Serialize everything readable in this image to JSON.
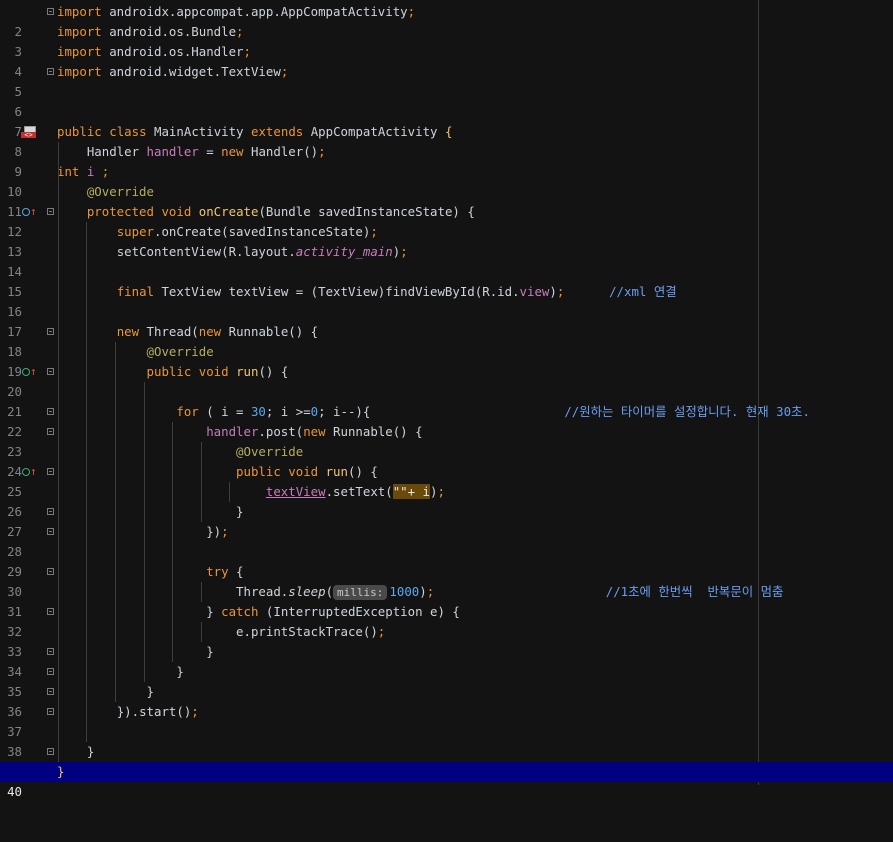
{
  "editor": {
    "current_line": 40,
    "lines": [
      {
        "n": "2",
        "text": "import androidx.appcompat.app.AppCompatActivity;"
      },
      {
        "n": "3",
        "text": "import android.os.Bundle;"
      },
      {
        "n": "4",
        "text": "import android.os.Handler;"
      },
      {
        "n": "5",
        "text": "import android.widget.TextView;"
      },
      {
        "n": "6",
        "text": ""
      },
      {
        "n": "7",
        "text": ""
      },
      {
        "n": "8",
        "text": "public class MainActivity extends AppCompatActivity {"
      },
      {
        "n": "9",
        "text": "    Handler handler = new Handler();"
      },
      {
        "n": "10",
        "text": "int i ;"
      },
      {
        "n": "11",
        "text": "    @Override"
      },
      {
        "n": "12",
        "text": "    protected void onCreate(Bundle savedInstanceState) {"
      },
      {
        "n": "13",
        "text": "        super.onCreate(savedInstanceState);"
      },
      {
        "n": "14",
        "text": "        setContentView(R.layout.activity_main);"
      },
      {
        "n": "15",
        "text": ""
      },
      {
        "n": "16",
        "text": "        final TextView textView = (TextView)findViewById(R.id.view);      //xml 연결"
      },
      {
        "n": "17",
        "text": ""
      },
      {
        "n": "18",
        "text": "        new Thread(new Runnable() {"
      },
      {
        "n": "19",
        "text": "            @Override"
      },
      {
        "n": "20",
        "text": "            public void run() {"
      },
      {
        "n": "21",
        "text": ""
      },
      {
        "n": "22",
        "text": "                for ( i = 30; i >=0; i--){                             //원하는 타이머를 설정합니다. 현재 30초."
      },
      {
        "n": "23",
        "text": "                    handler.post(new Runnable() {"
      },
      {
        "n": "24",
        "text": "                        @Override"
      },
      {
        "n": "25",
        "text": "                        public void run() {"
      },
      {
        "n": "26",
        "text": "                            textView.setText(\"\"+ i);"
      },
      {
        "n": "27",
        "text": "                        }"
      },
      {
        "n": "28",
        "text": "                    });"
      },
      {
        "n": "29",
        "text": ""
      },
      {
        "n": "30",
        "text": "                    try {"
      },
      {
        "n": "31",
        "text": "                        Thread.sleep( millis: 1000);                         //1초에 한번씩  반복문이 멈춤"
      },
      {
        "n": "32",
        "text": "                    } catch (InterruptedException e) {"
      },
      {
        "n": "33",
        "text": "                        e.printStackTrace();"
      },
      {
        "n": "34",
        "text": "                    }"
      },
      {
        "n": "35",
        "text": "                }"
      },
      {
        "n": "36",
        "text": "            }"
      },
      {
        "n": "37",
        "text": "        }).start();"
      },
      {
        "n": "38",
        "text": ""
      },
      {
        "n": "39",
        "text": "    }"
      },
      {
        "n": "40",
        "text": "}"
      }
    ],
    "tokens": {
      "l2": {
        "kw": "import",
        "rest": " androidx.appcompat.app.AppCompatActivity",
        "semi": ";"
      },
      "l3": {
        "kw": "import",
        "rest": " android.os.Bundle",
        "semi": ";"
      },
      "l4": {
        "kw": "import",
        "rest": " android.os.Handler",
        "semi": ";"
      },
      "l5": {
        "kw": "import",
        "rest": " android.widget.TextView",
        "semi": ";"
      },
      "l8": {
        "kw1": "public",
        "kw2": "class",
        "name": "MainActivity",
        "kw3": "extends",
        "base": "AppCompatActivity",
        "brace": "{"
      },
      "l9": {
        "type": "Handler",
        "field": "handler",
        "eq": " = ",
        "kw": "new",
        "call": " Handler()",
        "semi": ";"
      },
      "l10": {
        "kw": "int",
        "field": "i",
        "semi": ";"
      },
      "l11": {
        "ann": "@Override"
      },
      "l12": {
        "kw1": "protected",
        "kw2": "void",
        "fn": "onCreate",
        "args": "(Bundle savedInstanceState) {"
      },
      "l13": {
        "kw": "super",
        "rest": ".onCreate(savedInstanceState)",
        "semi": ";"
      },
      "l14": {
        "pre": "setContentView(R.layout.",
        "field": "activity_main",
        "post": ")",
        "semi": ";"
      },
      "l16": {
        "kw": "final",
        "mid": " TextView textView = (TextView)findViewById(R.id.",
        "field": "view",
        "post": ")",
        "semi": ";",
        "comment": "//xml 연결"
      },
      "l18": {
        "kw1": "new",
        "mid1": " Thread(",
        "kw2": "new",
        "mid2": " Runnable() {"
      },
      "l19": {
        "ann": "@Override"
      },
      "l20": {
        "kw1": "public",
        "kw2": "void",
        "fn": "run",
        "rest": "() {"
      },
      "l22": {
        "kw": "for",
        "p1": " ( i = ",
        "num1": "30",
        "p2": "; i >=",
        "num2": "0",
        "p3": "; i--){",
        "comment": "//원하는 타이머를 설정합니다. 현재 30초."
      },
      "l23": {
        "field": "handler",
        "mid": ".post(",
        "kw": "new",
        "rest": " Runnable() {"
      },
      "l24": {
        "ann": "@Override"
      },
      "l25": {
        "kw1": "public",
        "kw2": "void",
        "fn": "run",
        "rest": "() {"
      },
      "l26": {
        "field": "textView",
        "mid": ".setText(",
        "hl": "\"\"+ i",
        "post": ")",
        "semi": ";"
      },
      "l27": {
        "text": "}"
      },
      "l28": {
        "text": "})",
        "semi": ";"
      },
      "l30": {
        "kw": "try",
        "rest": " {"
      },
      "l31": {
        "pre": "Thread.",
        "method": "sleep",
        "open": "(",
        "hint": "millis:",
        "num": "1000",
        "post": ")",
        "semi": ";",
        "comment": "//1초에 한번씩  반복문이 멈춤"
      },
      "l32": {
        "pre": "} ",
        "kw": "catch",
        "rest": " (InterruptedException e) {"
      },
      "l33": {
        "text": "e.printStackTrace()",
        "semi": ";"
      },
      "l34": {
        "text": "}"
      },
      "l35": {
        "text": "}"
      },
      "l36": {
        "text": "}"
      },
      "l37": {
        "text": "}).start()",
        "semi": ";"
      },
      "l39": {
        "text": "}"
      },
      "l40": {
        "text": "}"
      }
    }
  }
}
